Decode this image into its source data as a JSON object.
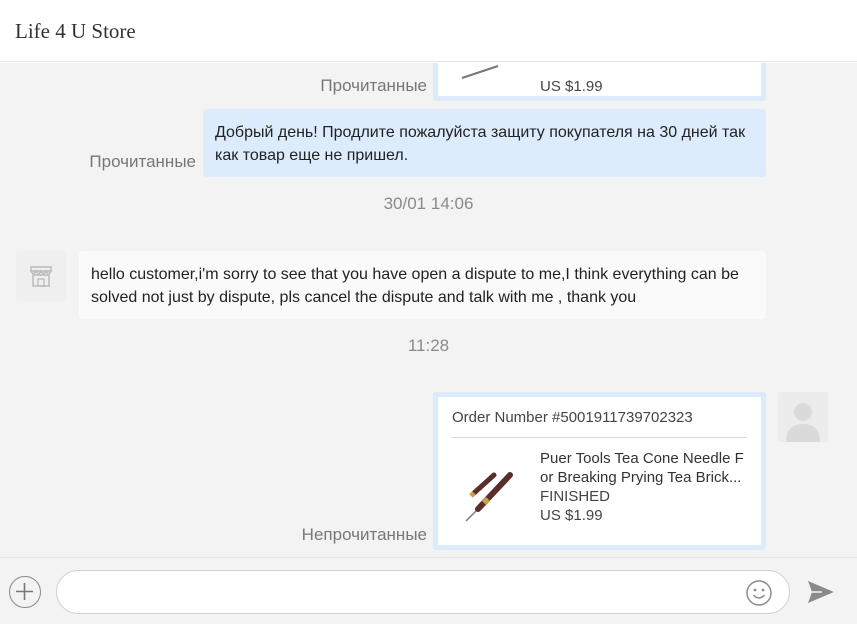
{
  "header": {
    "title": "Life 4 U Store"
  },
  "messages": {
    "top_card": {
      "price": "US $1.99",
      "status": "Прочитанные"
    },
    "msg1": {
      "text": "Добрый день! Продлите пожалуйста защиту покупателя на 30 дней так как товар еще не пришел.",
      "status": "Прочитанные"
    },
    "ts1": "30/01 14:06",
    "msg2": {
      "text": "hello customer,i'm sorry to see that you have open a dispute to me,I think everything can be solved not just by dispute,  pls cancel the dispute and talk with me , thank you"
    },
    "ts2": "11:28",
    "order": {
      "number": "Order Number #5001911739702323",
      "product_name": "Puer Tools Tea Cone Needle F or Breaking Prying Tea Brick...",
      "product_status": "FINISHED",
      "price": "US $1.99",
      "status": "Непрочитанные"
    }
  },
  "composer": {
    "placeholder": ""
  },
  "icons": {
    "plus": "plus-icon",
    "emoji": "emoji-icon",
    "send": "send-icon",
    "store_avatar": "store-icon",
    "user_avatar": "user-icon"
  },
  "colors": {
    "outgoing_bubble": "#dcecfd",
    "card_border": "#dcebfb",
    "chat_bg": "#f3f3f3"
  }
}
